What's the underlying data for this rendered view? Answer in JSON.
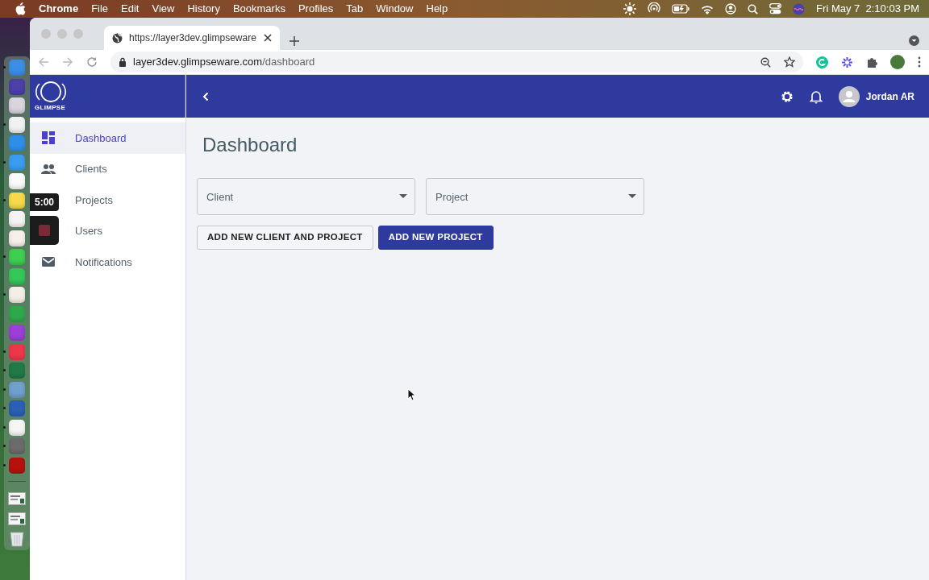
{
  "menubar": {
    "app": "Chrome",
    "menus": [
      "File",
      "Edit",
      "View",
      "History",
      "Bookmarks",
      "Profiles",
      "Tab",
      "Window",
      "Help"
    ],
    "clock": "Fri May 7  2:10:03 PM"
  },
  "dock": {
    "items": [
      {
        "kind": "app",
        "color": "#3a8ee6",
        "running": true
      },
      {
        "kind": "app",
        "color": "#4b3fa8",
        "running": false
      },
      {
        "kind": "app",
        "color": "#d9d4de",
        "running": false
      },
      {
        "kind": "app",
        "color": "#f2f2f2",
        "running": true
      },
      {
        "kind": "app",
        "color": "#2f8fe8",
        "running": false
      },
      {
        "kind": "app",
        "color": "#3b9bf0",
        "running": true
      },
      {
        "kind": "app",
        "color": "#fafafa",
        "running": false
      },
      {
        "kind": "app",
        "color": "#f5d94a",
        "running": true
      },
      {
        "kind": "app",
        "color": "#f4f4f4",
        "running": false
      },
      {
        "kind": "app",
        "color": "#f7f0e8",
        "running": false
      },
      {
        "kind": "app",
        "color": "#3dcf4f",
        "running": true
      },
      {
        "kind": "app",
        "color": "#34c759",
        "running": false
      },
      {
        "kind": "app",
        "color": "#f3efe6",
        "running": true
      },
      {
        "kind": "app",
        "color": "#2ea84a",
        "running": false
      },
      {
        "kind": "app",
        "color": "#9b3fd6",
        "running": false
      },
      {
        "kind": "app",
        "color": "#f0354a",
        "running": true
      },
      {
        "kind": "app",
        "color": "#1f7a45",
        "running": true
      },
      {
        "kind": "app",
        "color": "#6fa0d0",
        "running": true
      },
      {
        "kind": "app",
        "color": "#2b5fb4",
        "running": true
      },
      {
        "kind": "app",
        "color": "#f5f5f5",
        "running": true
      },
      {
        "kind": "app",
        "color": "#6b6b6b",
        "running": true
      },
      {
        "kind": "app",
        "color": "#b5120e",
        "running": true
      },
      {
        "kind": "separator"
      },
      {
        "kind": "document"
      },
      {
        "kind": "document"
      },
      {
        "kind": "trash"
      }
    ]
  },
  "browser": {
    "tab": {
      "title": "https://layer3dev.glimpseware"
    },
    "address": {
      "host": "layer3dev.glimpseware.com",
      "path": "/dashboard"
    }
  },
  "app": {
    "logo": "GLIMPSE",
    "user": "Jordan AR",
    "title": "Dashboard",
    "nav": [
      {
        "label": "Dashboard",
        "kind": "dashboard",
        "selected": true
      },
      {
        "label": "Clients",
        "kind": "people",
        "selected": false
      },
      {
        "label": "Projects",
        "selected": false
      },
      {
        "label": "Users",
        "selected": false
      },
      {
        "label": "Notifications",
        "kind": "mail",
        "selected": false
      }
    ],
    "selects": [
      {
        "placeholder": "Client"
      },
      {
        "placeholder": "Project"
      }
    ],
    "buttons": [
      {
        "label": "ADD NEW CLIENT AND PROJECT",
        "kind": "outline"
      },
      {
        "label": "ADD NEW PROJECT",
        "kind": "primary"
      }
    ]
  },
  "recorder": {
    "timer": "5:00"
  }
}
